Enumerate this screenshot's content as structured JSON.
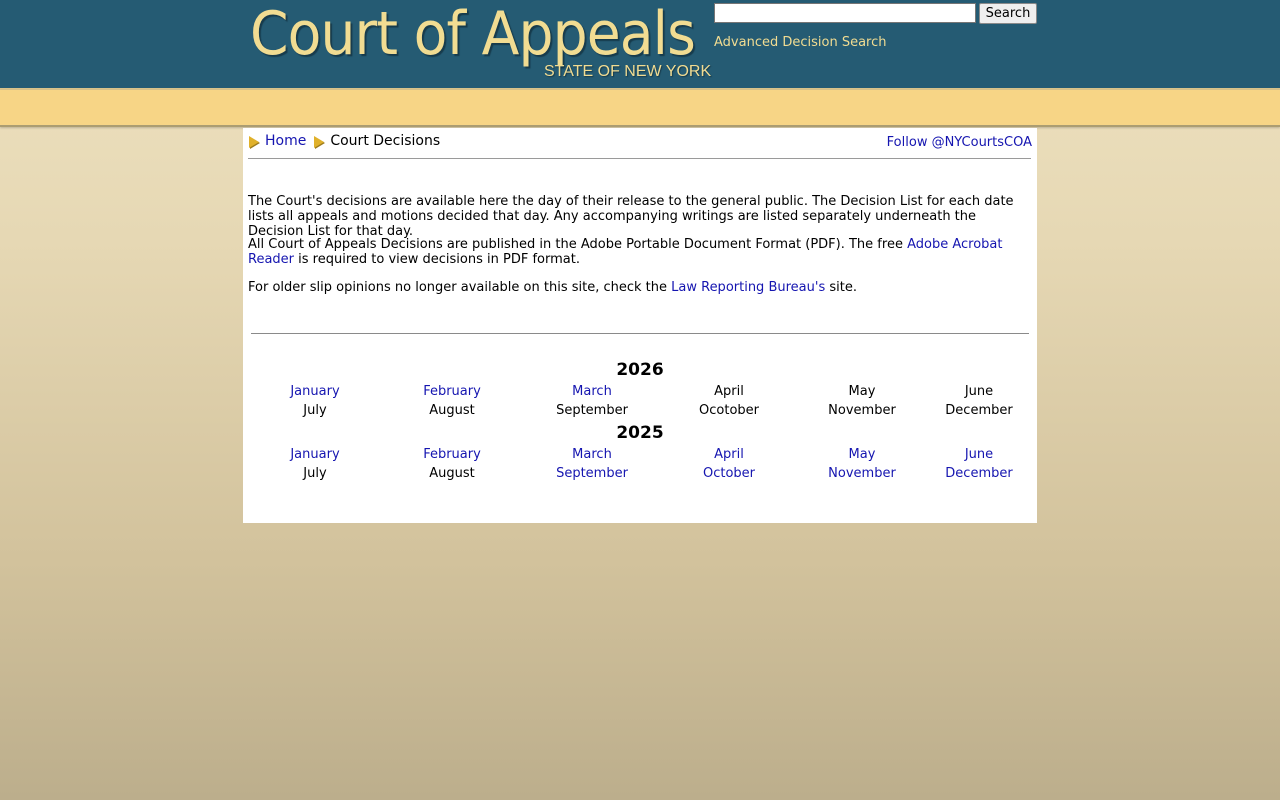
{
  "header": {
    "logo_title": "Court of Appeals",
    "logo_subtitle": "STATE OF NEW YORK",
    "search_button": "Search",
    "search_value": "",
    "advanced_search": "Advanced Decision Search"
  },
  "breadcrumb": {
    "home": "Home",
    "current": "Court Decisions"
  },
  "follow_link": "Follow @NYCourtsCOA",
  "intro": {
    "p1": "The Court's decisions are available here the day of their release to the general public. The Decision List for each date lists all appeals and motions decided that day. Any accompanying writings are listed separately underneath the Decision List for that day.",
    "p2_before": "All Court of Appeals Decisions are published in the Adobe Portable Document Format (PDF). The free ",
    "p2_link": "Adobe Acrobat Reader",
    "p2_after": " is required to view decisions in PDF format.",
    "p3_before": "For older slip opinions no longer available on this site, check the ",
    "p3_link": "Law Reporting Bureau's",
    "p3_after": " site."
  },
  "calendar": {
    "years": [
      {
        "year": "2026",
        "row1": [
          "January",
          "February",
          "March",
          "April",
          "May",
          "June"
        ],
        "row2": [
          "July",
          "August",
          "September",
          "Ocotober",
          "November",
          "December"
        ],
        "row1_linked": [
          true,
          true,
          true,
          false,
          false,
          false
        ],
        "row2_linked": [
          false,
          false,
          false,
          false,
          false,
          false
        ]
      },
      {
        "year": "2025",
        "row1": [
          "January",
          "February",
          "March",
          "April",
          "May",
          "June"
        ],
        "row2": [
          "July",
          "August",
          "September",
          "October",
          "November",
          "December"
        ],
        "row1_linked": [
          true,
          true,
          true,
          true,
          true,
          true
        ],
        "row2_linked": [
          false,
          false,
          true,
          true,
          true,
          true
        ]
      }
    ]
  },
  "colors": {
    "header_bg": "#255b73",
    "logo_text": "#f1dc92",
    "band": "#f7d586",
    "link": "#1515b0"
  }
}
